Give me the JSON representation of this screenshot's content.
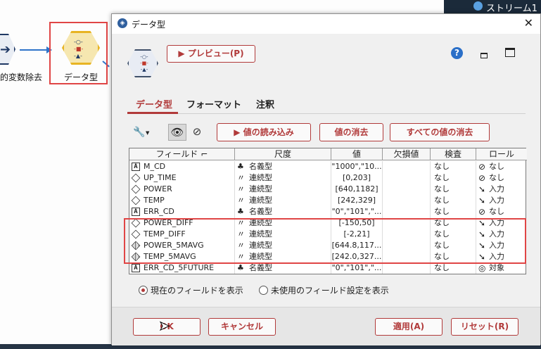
{
  "background": {
    "node_prev_label": "的変数除去",
    "node_type_label": "データ型",
    "stream_label": "ストリーム1"
  },
  "dialog": {
    "title": "データ型",
    "close_glyph": "✕",
    "preview_button": "▶ プレビュー(P)",
    "help_glyph": "?",
    "tabs": [
      "データ型",
      "フォーマット",
      "注釈"
    ],
    "toolbar": {
      "read_values_button": "▶ 値の読み込み",
      "clear_values_button": "値の消去",
      "clear_all_values_button": "すべての値の消去"
    },
    "table": {
      "headers": [
        "フィールド ⌐",
        "尺度",
        "値",
        "欠損値",
        "検査",
        "ロール"
      ],
      "rows": [
        {
          "type_icon": "A",
          "field": "M_CD",
          "measure_icon": "nominal-icon",
          "measure": "名義型",
          "value": "\"1000\",\"10...",
          "missing": "",
          "check": "なし",
          "role_icon": "none-icon",
          "role": "なし"
        },
        {
          "type_icon": "diamond",
          "field": "UP_TIME",
          "measure_icon": "continuous-icon",
          "measure": "連続型",
          "value": "[0,203]",
          "missing": "",
          "check": "なし",
          "role_icon": "none-icon",
          "role": "なし"
        },
        {
          "type_icon": "diamond",
          "field": "POWER",
          "measure_icon": "continuous-icon",
          "measure": "連続型",
          "value": "[640,1182]",
          "missing": "",
          "check": "なし",
          "role_icon": "input-icon",
          "role": "入力"
        },
        {
          "type_icon": "diamond",
          "field": "TEMP",
          "measure_icon": "continuous-icon",
          "measure": "連続型",
          "value": "[242,329]",
          "missing": "",
          "check": "なし",
          "role_icon": "input-icon",
          "role": "入力"
        },
        {
          "type_icon": "A",
          "field": "ERR_CD",
          "measure_icon": "nominal-icon",
          "measure": "名義型",
          "value": "\"0\",\"101\",\"...",
          "missing": "",
          "check": "なし",
          "role_icon": "none-icon",
          "role": "なし"
        },
        {
          "type_icon": "diamond",
          "field": "POWER_DIFF",
          "measure_icon": "continuous-icon",
          "measure": "連続型",
          "value": "[-150,50]",
          "missing": "",
          "check": "なし",
          "role_icon": "input-icon",
          "role": "入力"
        },
        {
          "type_icon": "diamond",
          "field": "TEMP_DIFF",
          "measure_icon": "continuous-icon",
          "measure": "連続型",
          "value": "[-2,21]",
          "missing": "",
          "check": "なし",
          "role_icon": "input-icon",
          "role": "入力"
        },
        {
          "type_icon": "derived-diamond",
          "field": "POWER_5MAVG",
          "measure_icon": "continuous-icon",
          "measure": "連続型",
          "value": "[644.8,117...",
          "missing": "",
          "check": "なし",
          "role_icon": "input-icon",
          "role": "入力"
        },
        {
          "type_icon": "derived-diamond",
          "field": "TEMP_5MAVG",
          "measure_icon": "continuous-icon",
          "measure": "連続型",
          "value": "[242.0,327...",
          "missing": "",
          "check": "なし",
          "role_icon": "input-icon",
          "role": "入力"
        },
        {
          "type_icon": "A",
          "field": "ERR_CD_5FUTURE",
          "measure_icon": "nominal-icon",
          "measure": "名義型",
          "value": "\"0\",\"101\",\"...",
          "missing": "",
          "check": "なし",
          "role_icon": "target-icon",
          "role": "対象"
        }
      ]
    },
    "radios": {
      "current_fields": "現在のフィールドを表示",
      "unused_fields": "未使用のフィールド設定を表示",
      "selected": "current_fields"
    },
    "footer": {
      "ok_button": "OK",
      "cancel_button": "キャンセル",
      "apply_button": "適用(A)",
      "reset_button": "リセット(R)"
    }
  },
  "colors": {
    "accent": "#b13a3a",
    "highlight": "#e04545",
    "flow_line": "#2f74c9"
  }
}
